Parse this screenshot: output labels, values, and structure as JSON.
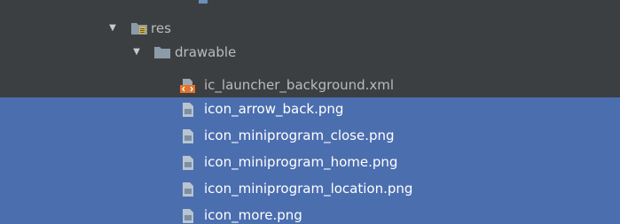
{
  "project_tree": {
    "res_folder": {
      "label": "res",
      "icon": "resource-folder-icon"
    },
    "drawable_folder": {
      "label": "drawable",
      "icon": "folder-icon"
    },
    "files": [
      {
        "label": "ic_launcher_background.xml",
        "icon": "xml-file-icon",
        "selected": false
      },
      {
        "label": "icon_arrow_back.png",
        "icon": "image-file-icon",
        "selected": true
      },
      {
        "label": "icon_miniprogram_close.png",
        "icon": "image-file-icon",
        "selected": true
      },
      {
        "label": "icon_miniprogram_home.png",
        "icon": "image-file-icon",
        "selected": true
      },
      {
        "label": "icon_miniprogram_location.png",
        "icon": "image-file-icon",
        "selected": true
      },
      {
        "label": "icon_more.png",
        "icon": "image-file-icon",
        "selected": true
      }
    ]
  },
  "colors": {
    "background": "#3c3f41",
    "selection": "#4b6eaf",
    "text": "#bbbbbb",
    "selected_text": "#ffffff",
    "folder": "#8c9ba8",
    "xml_icon": "#e3732c",
    "image_icon": "#b8c4d0"
  }
}
